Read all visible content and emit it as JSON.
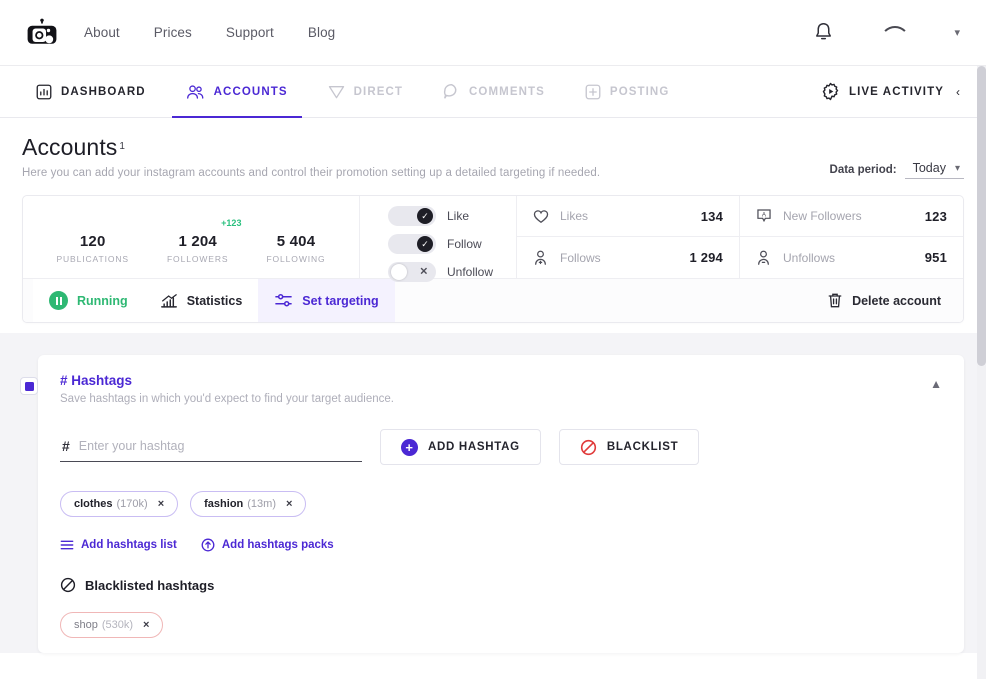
{
  "header": {
    "logo_icon": "instagram-robot-logo",
    "nav": [
      {
        "label": "About"
      },
      {
        "label": "Prices"
      },
      {
        "label": "Support"
      },
      {
        "label": "Blog"
      }
    ],
    "bell_icon": "bell-icon",
    "avatar_icon": "user-avatar",
    "account_chevron": "chevron-down-icon"
  },
  "tabs": [
    {
      "label": "DASHBOARD",
      "icon": "dashboard-chart-icon",
      "state": "dark"
    },
    {
      "label": "ACCOUNTS",
      "icon": "accounts-people-icon",
      "state": "active"
    },
    {
      "label": "DIRECT",
      "icon": "direct-send-icon",
      "state": "muted"
    },
    {
      "label": "COMMENTS",
      "icon": "comments-bubble-icon",
      "state": "muted"
    },
    {
      "label": "POSTING",
      "icon": "posting-plus-square-icon",
      "state": "muted"
    }
  ],
  "live_activity": {
    "label": "LIVE ACTIVITY",
    "icon": "gear-play-icon",
    "chevron": "chevron-left-icon"
  },
  "page": {
    "title": "Accounts",
    "title_superscript": "1",
    "subtitle": "Here you can add your instagram accounts and control their promotion setting up a detailed targeting if needed.",
    "data_period_label": "Data period:",
    "data_period_value": "Today",
    "data_period_chevron": "chevron-down-icon"
  },
  "account": {
    "profile_stats": [
      {
        "value": "120",
        "label": "PUBLICATIONS",
        "delta": ""
      },
      {
        "value": "1 204",
        "label": "FOLLOWERS",
        "delta": "+123"
      },
      {
        "value": "5 404",
        "label": "FOLLOWING",
        "delta": ""
      }
    ],
    "toggles": [
      {
        "label": "Like",
        "on": true
      },
      {
        "label": "Follow",
        "on": true
      },
      {
        "label": "Unfollow",
        "on": false
      }
    ],
    "metrics": [
      {
        "label": "Likes",
        "value": "134",
        "icon": "heart-icon"
      },
      {
        "label": "New Followers",
        "value": "123",
        "icon": "new-follower-badge-icon"
      },
      {
        "label": "Follows",
        "value": "1 294",
        "icon": "user-plus-icon"
      },
      {
        "label": "Unfollows",
        "value": "951",
        "icon": "user-minus-icon"
      }
    ],
    "card_tabs": [
      {
        "label": "Running",
        "icon": "pause-circle-icon"
      },
      {
        "label": "Statistics",
        "icon": "bar-chart-icon"
      },
      {
        "label": "Set targeting",
        "icon": "sliders-icon"
      }
    ],
    "delete_label": "Delete account",
    "delete_icon": "trash-icon"
  },
  "hashtags_panel": {
    "checkbox_icon": "checked-square-icon",
    "title": "# Hashtags",
    "description": "Save hashtags in which you'd expect to find your target audience.",
    "collapse_icon": "chevron-up-icon",
    "input_symbol": "#",
    "input_placeholder": "Enter your hashtag",
    "input_value": "",
    "add_button": "ADD HASHTAG",
    "add_button_icon": "plus-circle-icon",
    "blacklist_button": "BLACKLIST",
    "blacklist_button_icon": "prohibition-icon",
    "chips": [
      {
        "tag": "clothes",
        "count": "(170k)",
        "remove": "×"
      },
      {
        "tag": "fashion",
        "count": "(13m)",
        "remove": "×"
      }
    ],
    "links": [
      {
        "label": "Add hashtags list",
        "icon": "list-lines-icon"
      },
      {
        "label": "Add hashtags packs",
        "icon": "package-upload-icon"
      }
    ],
    "blacklist_heading": "Blacklisted hashtags",
    "blacklist_heading_icon": "prohibition-icon",
    "blacklist_chips": [
      {
        "tag": "shop",
        "count": "(530k)",
        "remove": "×"
      }
    ]
  },
  "colors": {
    "accent_purple": "#4b28d4",
    "green": "#2eb873",
    "red": "#e03b3b",
    "muted": "#c6c6cf"
  }
}
